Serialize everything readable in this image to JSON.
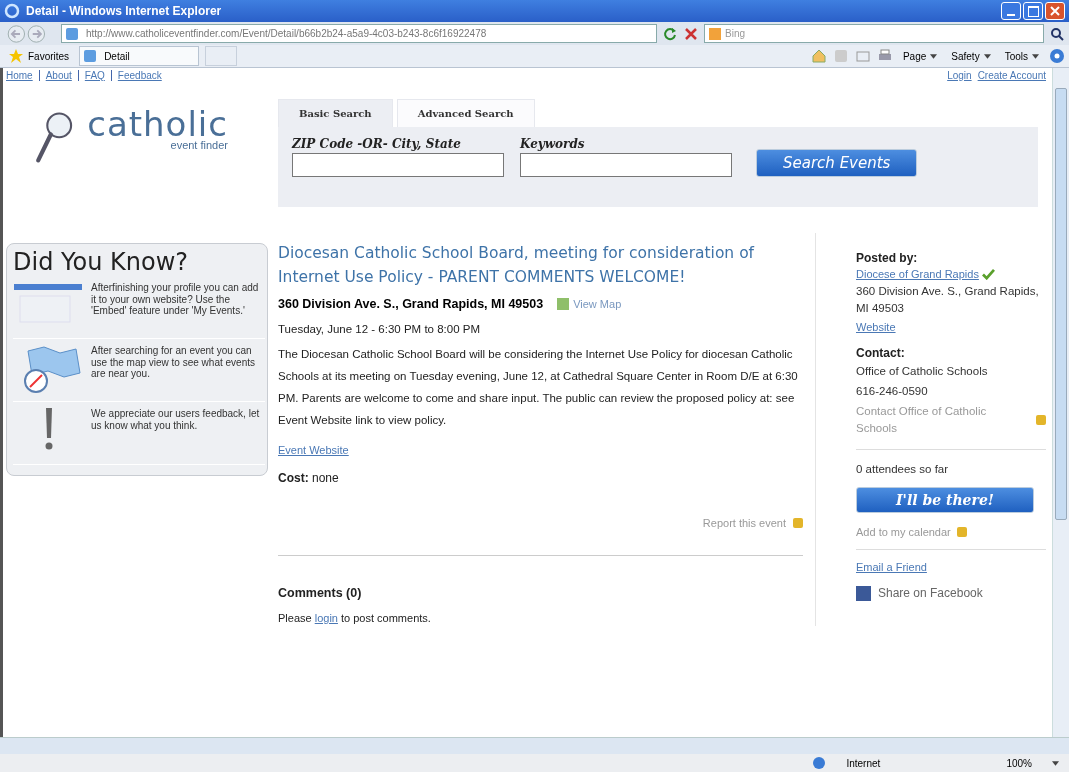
{
  "window": {
    "title": "Detail - Windows Internet Explorer"
  },
  "address_bar": {
    "url": "http://www.catholiceventfinder.com/Event/Detail/b66b2b24-a5a9-4c03-b243-8c6f16922478",
    "search_placeholder": "Bing"
  },
  "favorites_bar": {
    "favorites": "Favorites",
    "tab": "Detail",
    "menus": [
      "Page",
      "Safety",
      "Tools"
    ]
  },
  "top_links": [
    "Home",
    "About",
    "FAQ",
    "Feedback"
  ],
  "account_links": [
    "Login",
    "Create Account"
  ],
  "logo": {
    "word": "catholic",
    "tagline": "event finder"
  },
  "search": {
    "tabs": [
      {
        "label": "Basic Search",
        "selected": true
      },
      {
        "label": "Advanced Search",
        "selected": false
      }
    ],
    "fields": [
      {
        "label": "ZIP Code -OR- City, State"
      },
      {
        "label": "Keywords"
      }
    ],
    "button": "Search Events"
  },
  "did_you_know": {
    "title": "Did You Know?",
    "tips": [
      "Afterfinishing your profile you can add it to your own website?  Use the 'Embed' feature under 'My Events.'",
      "After searching for an event you can use the map view to see what events are near you.",
      "We appreciate our users feedback, let us know what you think."
    ]
  },
  "event": {
    "title": "Diocesan Catholic School Board, meeting for consideration of Internet Use Policy - PARENT COMMENTS WELCOME!",
    "address": "360 Division Ave. S., Grand Rapids, MI 49503",
    "map_link": "View Map",
    "when": "Tuesday, June 12 - 6:30 PM to 8:00 PM",
    "description": "The Diocesan Catholic School Board will be considering the Internet Use Policy for diocesan Catholic Schools at its meeting on Tuesday evening, June 12, at Cathedral Square Center in Room D/E at 6:30 PM. Parents are welcome to come and share input. The public can review the proposed policy at: see Event Website link to view policy.",
    "website_link": "Event Website",
    "cost": "**Cost:** none",
    "report_link": "Report this event"
  },
  "comments": {
    "title": "Comments (0)",
    "before": "Please",
    "link": "login",
    "after": "to post comments."
  },
  "sidebar": {
    "posted_by_label": "Posted by:",
    "poster": "Diocese of Grand Rapids",
    "poster_address": "360 Division Ave. S., Grand Rapids, MI 49503",
    "website": "Website",
    "contact_label": "Contact:",
    "contact_name": "Office of Catholic Schools",
    "phone": "616-246-0590",
    "contact_link": "Contact Office of Catholic Schools",
    "attendees": "0 attendees so far",
    "attend_button": "I'll be there!",
    "calendar_link": "Add to my calendar",
    "email_link": "Email a Friend",
    "facebook_link": "Share on Facebook"
  },
  "status_bar": {
    "zone": "Internet",
    "zoom": "100%"
  }
}
